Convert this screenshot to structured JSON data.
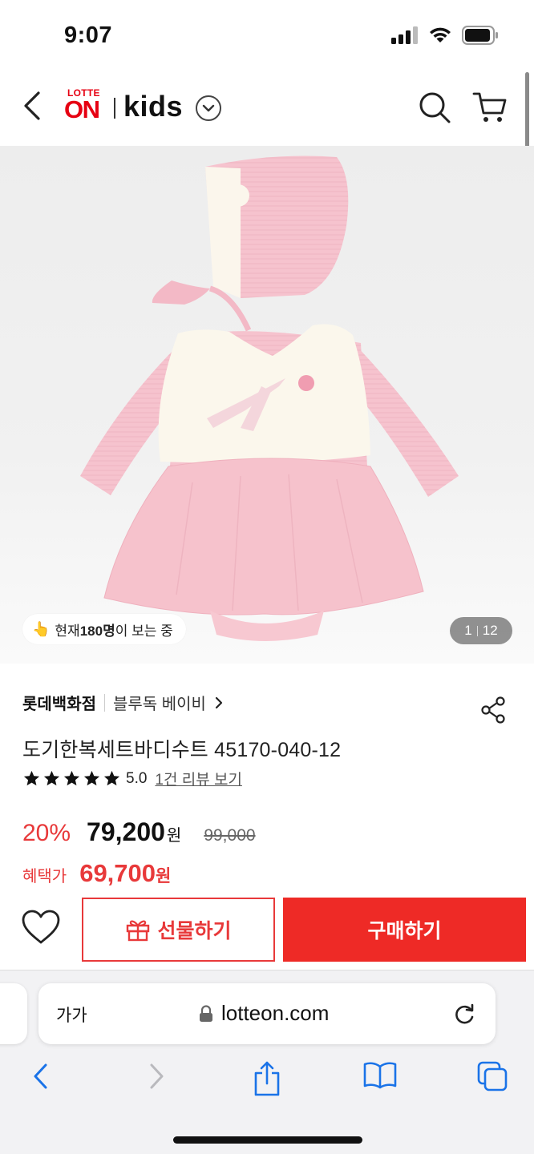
{
  "status_bar": {
    "time": "9:07"
  },
  "header": {
    "logo_top": "LOTTE",
    "logo_main": "ON",
    "logo_kids": "kids",
    "icons": [
      "back-icon",
      "chevron-down-icon",
      "search-icon",
      "cart-icon"
    ]
  },
  "gallery": {
    "viewer_prefix": "현재 ",
    "viewer_count": "180명",
    "viewer_suffix": "이 보는 중",
    "current_page": "1",
    "total_pages": "12"
  },
  "product": {
    "store": "롯데백화점",
    "brand": "블루독 베이비",
    "title": "도기한복세트바디수트 45170-040-12",
    "rating": "5.0",
    "review_link": "1건 리뷰 보기",
    "stars": 5
  },
  "price": {
    "discount": "20%",
    "sale_price": "79,200",
    "won": "원",
    "original_price": "99,000",
    "benefit_label": "혜택가",
    "benefit_price": "69,700",
    "benefit_won": "원"
  },
  "actions": {
    "gift_label": "선물하기",
    "buy_label": "구매하기"
  },
  "browser": {
    "text_size": "가가",
    "url": "lotteon.com"
  },
  "colors": {
    "brand_red": "#e60012",
    "price_red": "#e8393a",
    "buy_button": "#ee2a26",
    "safari_blue": "#1a73e8"
  }
}
